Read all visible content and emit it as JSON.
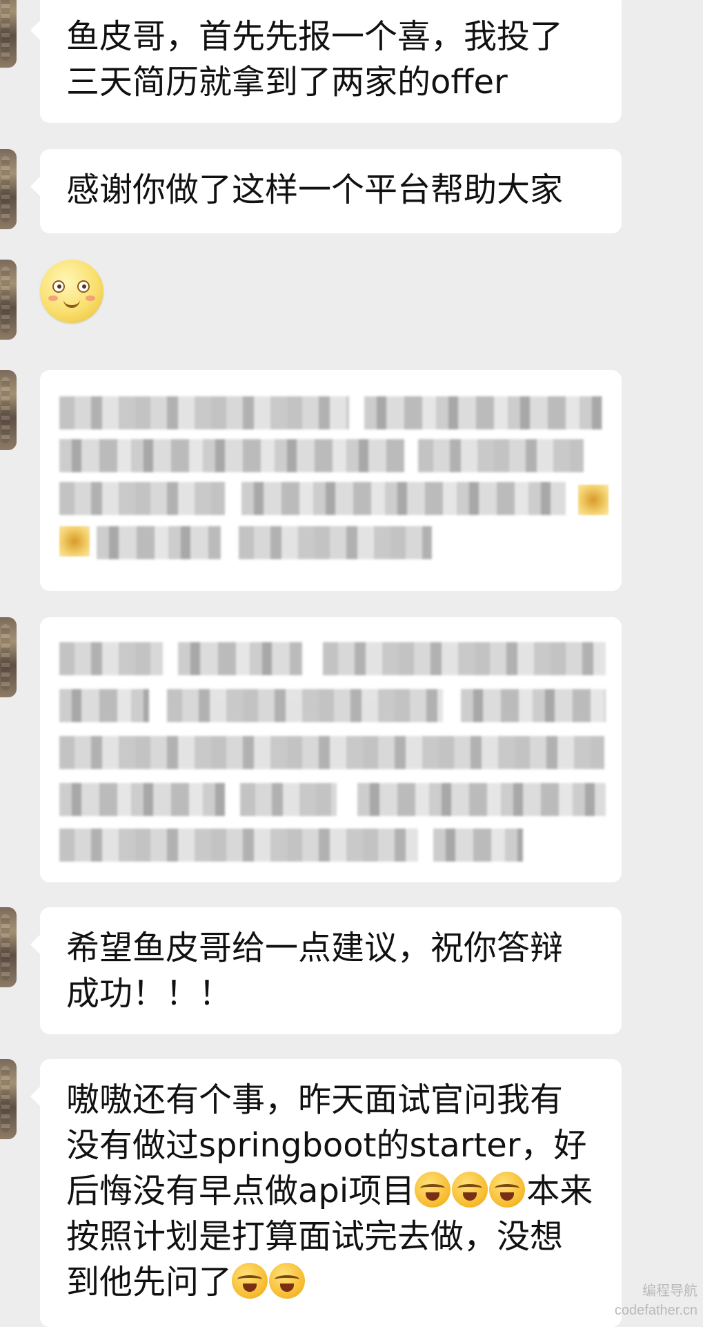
{
  "messages": [
    {
      "text": "鱼皮哥，首先先报一个喜，我投了三天简历就拿到了两家的offer"
    },
    {
      "text": "感谢你做了这样一个平台帮助大家"
    },
    {
      "emoji": "smiling-face-icon"
    },
    {
      "blurred": "pixelated-message"
    },
    {
      "blurred": "pixelated-message"
    },
    {
      "text": "希望鱼皮哥给一点建议，祝你答辩成功！！！"
    },
    {
      "part1": "嗷嗷还有个事，昨天面试官问我有没有做过springboot的starter，好后悔没有早点做api项目",
      "part2": "本来按照计划是打算面试完去做，没想到他先问了",
      "emoji": "crying-laughing-icon"
    }
  ],
  "watermark": {
    "line1": "编程导航",
    "line2": "codefather.cn"
  },
  "colors": {
    "background": "#ededed",
    "bubble": "#ffffff",
    "text": "#111111"
  }
}
